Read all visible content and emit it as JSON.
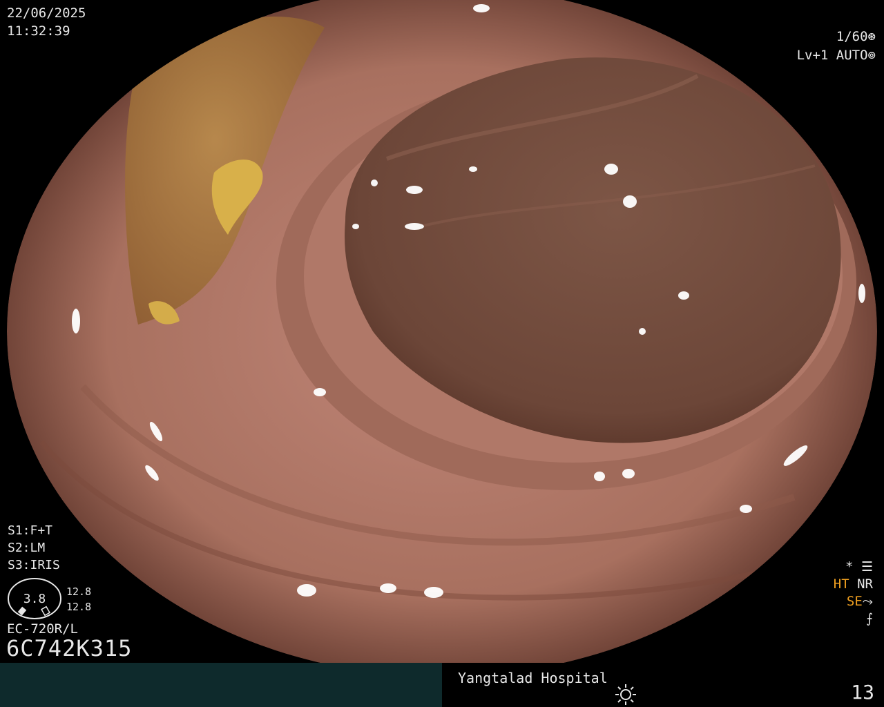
{
  "overlay": {
    "date": "22/06/2025",
    "time": "11:32:39",
    "shutter": "1/60",
    "shutter_icon": "aperture-icon",
    "level": "Lv+1",
    "mode": "AUTO",
    "mode_icon": "iris-icon",
    "s1": "S1:F+T",
    "s2": "S2:LM",
    "s3": "S3:IRIS",
    "gauge_value": "3.8",
    "gauge_top": "12.8",
    "gauge_bottom": "12.8",
    "model": "EC-720R/L",
    "serial": "6C742K315",
    "star": "*",
    "ht": "HT",
    "nr": "NR",
    "se": "SE",
    "freeze": "⨍"
  },
  "footer": {
    "hospital": "Yangtalad Hospital",
    "page": "13",
    "brightness_icon": "sun-icon"
  },
  "colors": {
    "mucosa": "#b57a6c",
    "lumen": "#6e4a3c",
    "bile": "#a67a3a",
    "orange_text": "#f0a020",
    "footer_bg": "#0e2a2c"
  }
}
